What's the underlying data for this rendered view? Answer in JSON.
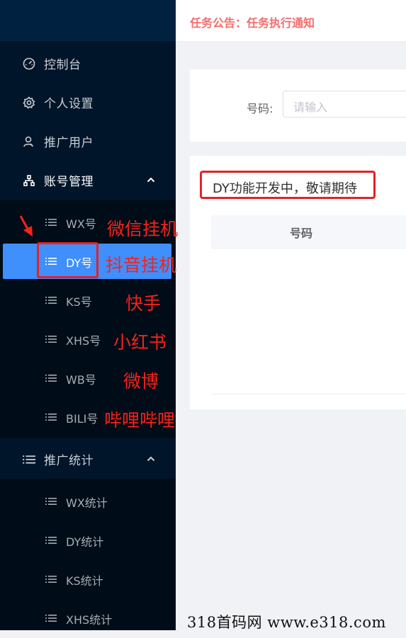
{
  "header": {
    "notice": "任务公告：任务执行通知"
  },
  "sidebar": {
    "items": [
      {
        "label": "控制台",
        "icon": "dashboard-icon"
      },
      {
        "label": "个人设置",
        "icon": "gear-icon"
      },
      {
        "label": "推广用户",
        "icon": "user-icon"
      },
      {
        "label": "账号管理",
        "icon": "network-icon",
        "expanded": true
      },
      {
        "label": "推广统计",
        "icon": "list-icon",
        "expanded": true
      }
    ],
    "account_sub": [
      {
        "label": "WX号"
      },
      {
        "label": "DY号",
        "active": true
      },
      {
        "label": "KS号"
      },
      {
        "label": "XHS号"
      },
      {
        "label": "WB号"
      },
      {
        "label": "BILI号"
      }
    ],
    "stats_sub": [
      {
        "label": "WX统计"
      },
      {
        "label": "DY统计"
      },
      {
        "label": "KS统计"
      },
      {
        "label": "XHS统计"
      }
    ]
  },
  "search": {
    "label": "号码:",
    "placeholder": "请输入"
  },
  "notice_box": "DY功能开发中，敬请期待",
  "table": {
    "headers": [
      "号码"
    ]
  },
  "annotations": [
    "微信挂机",
    "抖音挂机",
    "快手",
    "小红书",
    "微博",
    "哔哩哔哩"
  ],
  "watermark": "318首码网  www.e318.com",
  "colors": {
    "sidebar": "#001529",
    "active": "#3f8ffd",
    "annotation": "#f5221b",
    "notice": "#f56c6c"
  }
}
